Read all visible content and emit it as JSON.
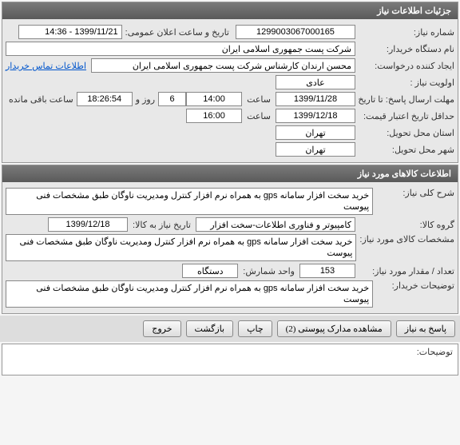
{
  "section1": {
    "header": "جزئیات اطلاعات نیاز",
    "need_number_label": "شماره نیاز:",
    "need_number": "1299003067000165",
    "public_datetime_label": "تاریخ و ساعت اعلان عمومی:",
    "public_datetime": "1399/11/21 - 14:36",
    "buyer_org_label": "نام دستگاه خریدار:",
    "buyer_org": "شرکت پست جمهوری اسلامی ایران",
    "creator_label": "ایجاد کننده درخواست:",
    "creator": "محسن ارندان کارشناس شرکت پست جمهوری اسلامی ایران",
    "contact_link": "اطلاعات تماس خریدار",
    "priority_label": "اولویت نیاز :",
    "priority": "عادی",
    "deadline_label": "مهلت ارسال پاسخ:  تا تاریخ :",
    "deadline_date": "1399/11/28",
    "time_label": "ساعت",
    "deadline_time": "14:00",
    "days_remaining": "6",
    "days_label": "روز و",
    "hours_remaining": "18:26:54",
    "hours_label": "ساعت باقی مانده",
    "min_credit_label": "حداقل تاریخ اعتبار قیمت:",
    "min_credit_date": "1399/12/18",
    "min_credit_time": "16:00",
    "delivery_province_label": "استان محل تحویل:",
    "delivery_province": "تهران",
    "delivery_city_label": "شهر محل تحویل:",
    "delivery_city": "تهران"
  },
  "section2": {
    "header": "اطلاعات کالاهای مورد نیاز",
    "general_desc_label": "شرح کلی نیاز:",
    "general_desc": "خرید سخت افزار سامانه gps به همراه نرم افزار کنترل ومدیریت ناوگان طبق مشخصات فنی پیوست",
    "group_label": "گروه کالا:",
    "group": "کامپیوتر و فناوری اطلاعات-سخت افزار",
    "need_until_label": "تاریخ نیاز به کالا:",
    "need_until": "1399/12/18",
    "item_spec_label": "مشخصات کالای مورد نیاز:",
    "item_spec": "خرید سخت افزار سامانه gps به همراه نرم افزار کنترل ومدیریت ناوگان طبق مشخصات فنی پیوست",
    "qty_label": "تعداد / مقدار مورد نیاز:",
    "qty": "153",
    "unit_label": "واحد شمارش:",
    "unit": "دستگاه",
    "buyer_notes_label": "توضیحات خریدار:",
    "buyer_notes": "خرید سخت افزار سامانه gps به همراه نرم افزار کنترل ومدیریت ناوگان طبق مشخصات فنی پیوست"
  },
  "buttons": {
    "respond": "پاسخ به نیاز",
    "attachments": "مشاهده مدارک پیوستی (2)",
    "print": "چاپ",
    "back": "بازگشت",
    "exit": "خروج"
  },
  "notes_label": "توضیحات:"
}
